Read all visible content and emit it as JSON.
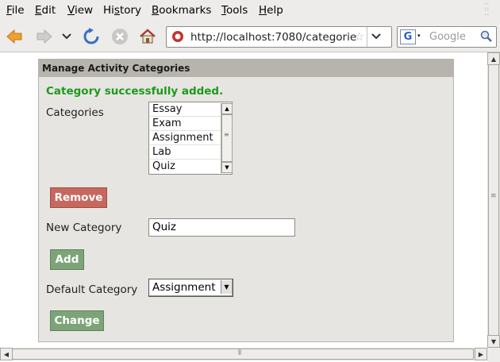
{
  "menubar": {
    "items": [
      "File",
      "Edit",
      "View",
      "History",
      "Bookmarks",
      "Tools",
      "Help"
    ]
  },
  "navbar": {
    "url": "http://localhost:7080/categorie",
    "search_placeholder": "Google"
  },
  "panel": {
    "title": "Manage Activity Categories",
    "success_message": "Category successfully added.",
    "categories_label": "Categories",
    "categories": [
      "Essay",
      "Exam",
      "Assignment",
      "Lab",
      "Quiz"
    ],
    "remove_label": "Remove",
    "new_category_label": "New Category",
    "new_category_value": "Quiz",
    "add_label": "Add",
    "default_category_label": "Default Category",
    "default_category_value": "Assignment",
    "change_label": "Change"
  }
}
